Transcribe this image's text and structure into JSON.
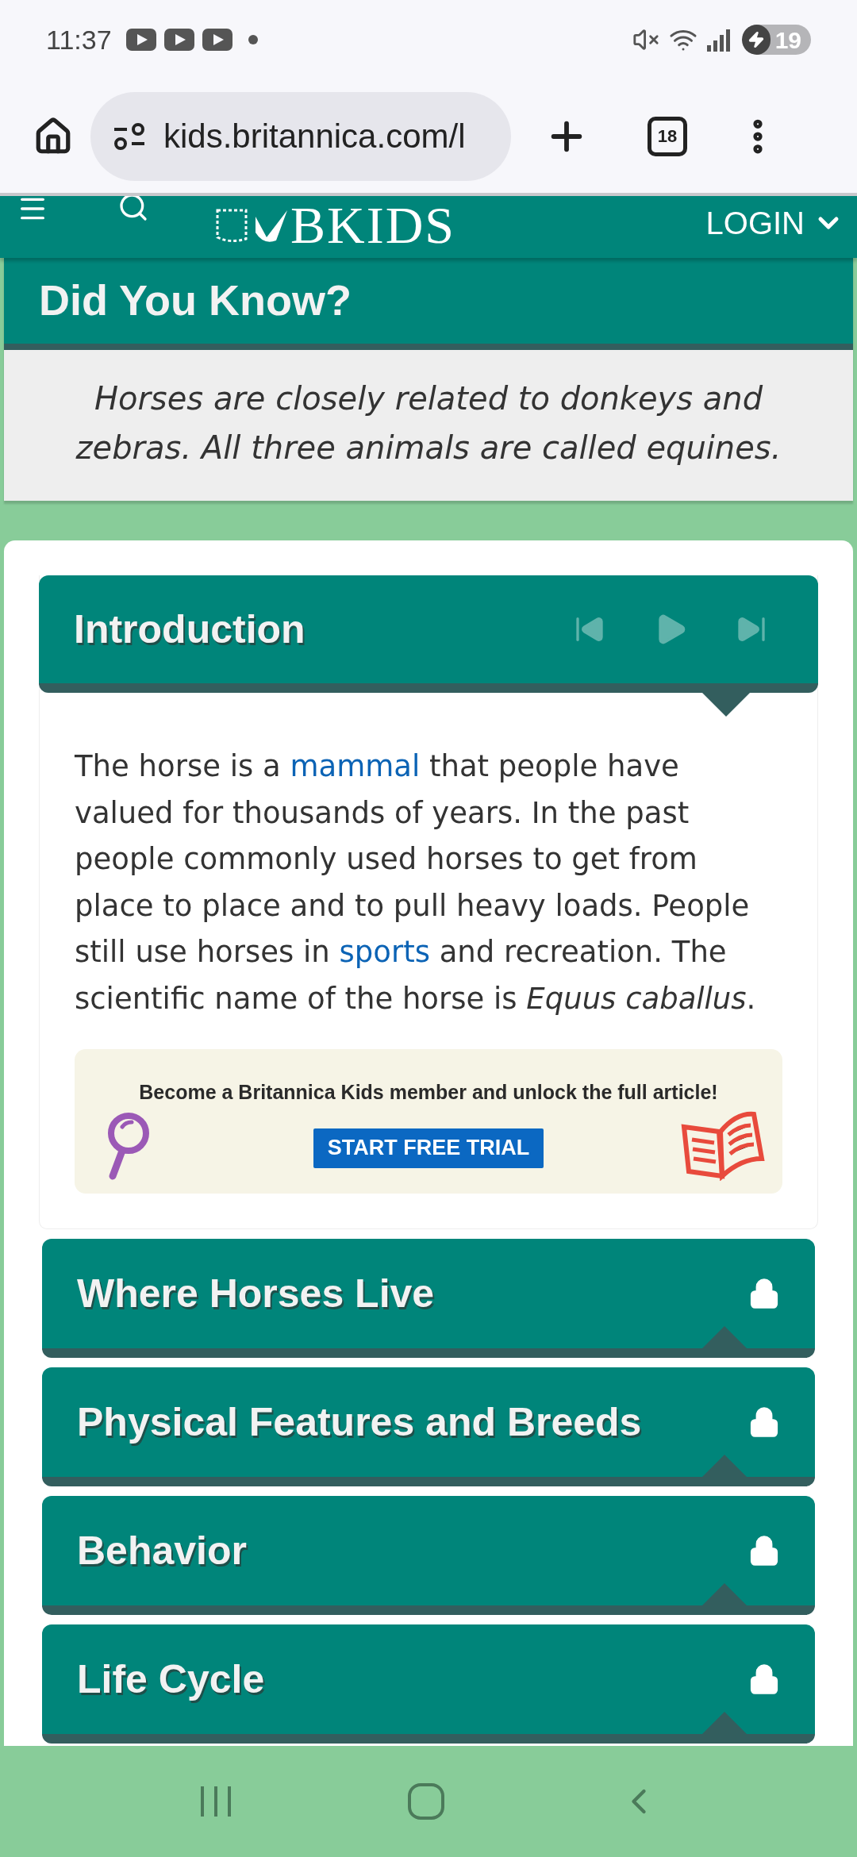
{
  "status_bar": {
    "time": "11:37",
    "notifications": [
      {
        "kind": "video"
      },
      {
        "kind": "video"
      },
      {
        "kind": "video"
      }
    ],
    "battery": "19"
  },
  "browser": {
    "url": "kids.britannica.com/l",
    "tab_count": "18"
  },
  "site_header": {
    "logo": "BKIDS",
    "login": "LOGIN"
  },
  "did_you_know": {
    "title": "Did You Know?",
    "text": "Horses are closely related to donkeys and zebras. All three animals are called equines."
  },
  "introduction": {
    "title": "Introduction",
    "paragraph": [
      {
        "kind": "text",
        "text": "The horse is a "
      },
      {
        "kind": "link",
        "text": "mammal"
      },
      {
        "kind": "text",
        "text": " that people have valued for thousands of years. In the past people commonly used horses to get from place to place and to pull heavy loads. People still use horses in "
      },
      {
        "kind": "link",
        "text": "sports"
      },
      {
        "kind": "text",
        "text": " and recreation. The scientific name of the horse is *Equus caballus*."
      }
    ],
    "promo": {
      "text": "Become a Britannica Kids member and unlock the full article!",
      "button": "START FREE TRIAL"
    }
  },
  "sections": [
    {
      "title": "Where Horses Live",
      "locked": true
    },
    {
      "title": "Physical Features and Breeds",
      "locked": true
    },
    {
      "title": "Behavior",
      "locked": true
    },
    {
      "title": "Life Cycle",
      "locked": true
    }
  ]
}
